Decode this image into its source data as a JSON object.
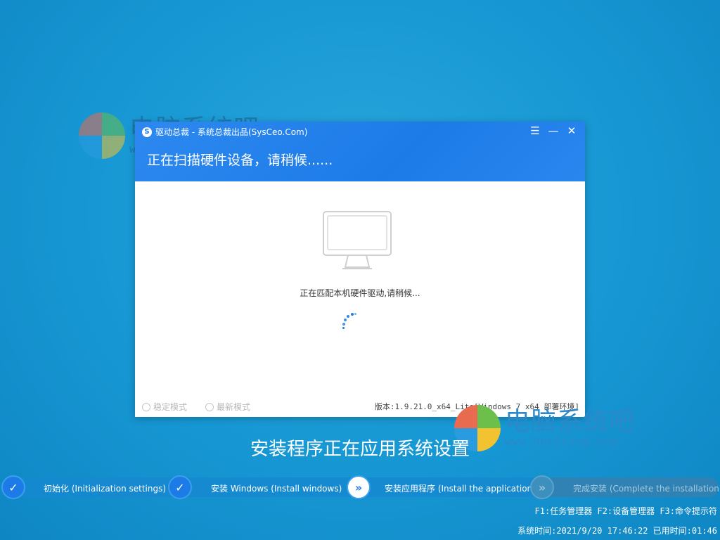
{
  "watermark": {
    "brand": "电脑系统吧",
    "url": "www.dnxitong.com"
  },
  "window": {
    "title": "驱动总裁 - 系统总裁出品(SysCeo.Com)",
    "heading": "正在扫描硬件设备，请稍候......",
    "scan_text": "正在匹配本机硬件驱动,请稍候...",
    "modes": [
      {
        "label": "稳定模式"
      },
      {
        "label": "最新模式"
      }
    ],
    "version": "版本:1.9.21.0_x64_Lite[Windows 7 x64 部署环境]"
  },
  "status_text": "安装程序正在应用系统设置",
  "steps": [
    {
      "label": "初始化 (Initialization settings)",
      "state": "done"
    },
    {
      "label": "安装 Windows (Install windows)",
      "state": "done"
    },
    {
      "label": "安装应用程序 (Install the application)",
      "state": "active"
    },
    {
      "label": "完成安装 (Complete the installation)",
      "state": "pending"
    }
  ],
  "hints": {
    "shortcuts": "F1:任务管理器 F2:设备管理器 F3:命令提示符",
    "time": "系统时间:2021/9/20 17:46:22 已用时间:01:46"
  },
  "colors": {
    "accent": "#1d7be8",
    "background": "#1697d3",
    "step_bar": "#1689d0",
    "pending_bar": "#2f82b3"
  }
}
